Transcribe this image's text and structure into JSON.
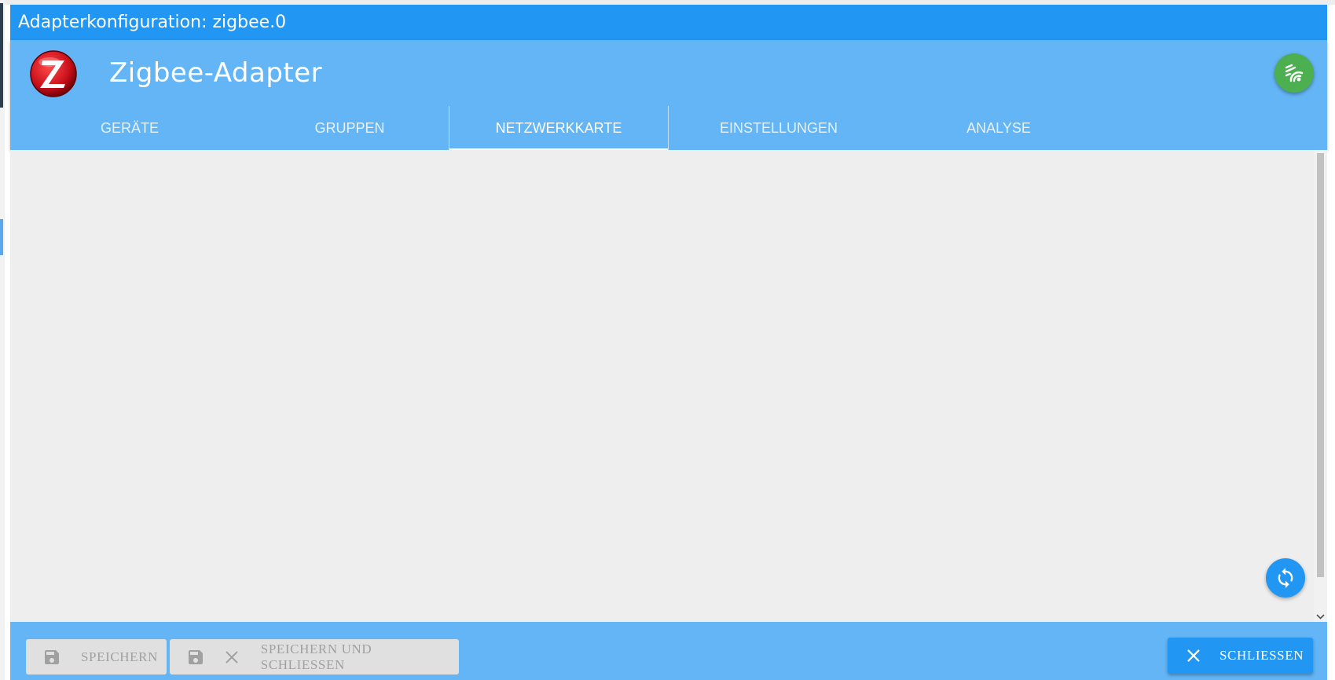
{
  "window": {
    "title": "Adapterkonfiguration: zigbee.0"
  },
  "header": {
    "adapter_title": "Zigbee-Adapter",
    "logo_icon": "zigbee-logo-icon",
    "status_icon": "wireless-signal-icon"
  },
  "tabs": [
    {
      "label": "GERÄTE",
      "active": false
    },
    {
      "label": "GRUPPEN",
      "active": false
    },
    {
      "label": "NETZWERKKARTE",
      "active": true
    },
    {
      "label": "EINSTELLUNGEN",
      "active": false
    },
    {
      "label": "ANALYSE",
      "active": false
    }
  ],
  "actions": {
    "refresh_icon": "refresh-icon"
  },
  "footer": {
    "save_label": "SPEICHERN",
    "save_close_label": "SPEICHERN UND SCHLIESSEN",
    "close_label": "SCHLIESSEN"
  },
  "colors": {
    "titlebar": "#2196f3",
    "header": "#64b5f6",
    "content_bg": "#eeeeee",
    "status_ok": "#4caf50",
    "primary": "#2196f3",
    "disabled_bg": "#e0e0e0"
  }
}
